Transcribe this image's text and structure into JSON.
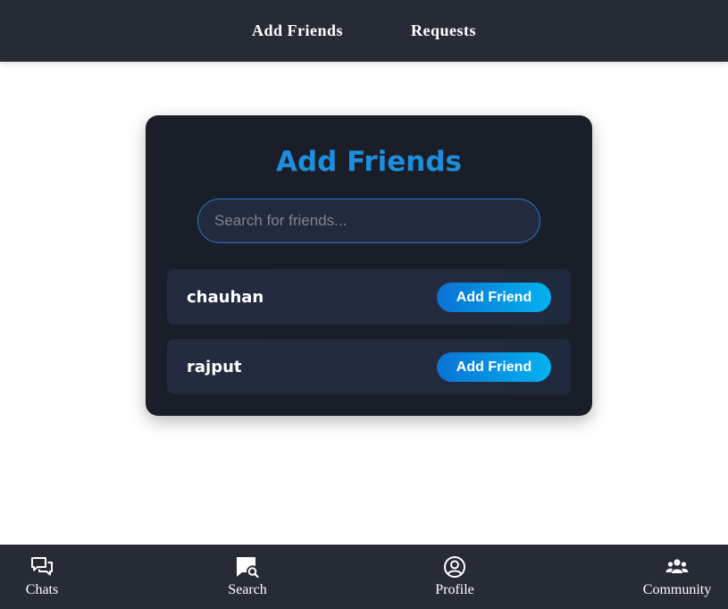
{
  "topnav": {
    "items": [
      {
        "label": "Add Friends"
      },
      {
        "label": "Requests"
      }
    ]
  },
  "card": {
    "title": "Add Friends",
    "search": {
      "placeholder": "Search for friends...",
      "value": ""
    },
    "results": [
      {
        "name": "chauhan",
        "action": "Add Friend"
      },
      {
        "name": "rajput",
        "action": "Add Friend"
      }
    ]
  },
  "bottomnav": {
    "items": [
      {
        "label": "Chats",
        "icon": "chats-icon"
      },
      {
        "label": "Search",
        "icon": "search-chat-icon"
      },
      {
        "label": "Profile",
        "icon": "profile-icon"
      },
      {
        "label": "Community",
        "icon": "community-icon"
      }
    ]
  },
  "colors": {
    "nav_bg": "#262b36",
    "card_bg": "#1a1e28",
    "accent": "#1e8ddb",
    "button_gradient_start": "#0a72d4",
    "button_gradient_end": "#04b2ef"
  }
}
